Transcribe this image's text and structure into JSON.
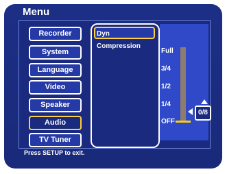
{
  "menu": {
    "title": "Menu"
  },
  "sidebar": {
    "items": [
      {
        "label": "Recorder"
      },
      {
        "label": "System"
      },
      {
        "label": "Language"
      },
      {
        "label": "Video"
      },
      {
        "label": "Speaker"
      },
      {
        "label": "Audio"
      },
      {
        "label": "TV Tuner"
      }
    ],
    "selected_index": 5
  },
  "submenu": {
    "items": [
      {
        "label": "Dyn Compression"
      }
    ],
    "selected_index": 0
  },
  "level": {
    "labels": [
      "Full",
      "3/4",
      "1/2",
      "1/4",
      "OFF"
    ],
    "value": "0/8",
    "fill_fraction": 0
  },
  "footer": {
    "hint": "Press SETUP to exit."
  },
  "colors": {
    "background": "#1c2f86",
    "accent": "#ffd040",
    "text": "#ffffff"
  }
}
